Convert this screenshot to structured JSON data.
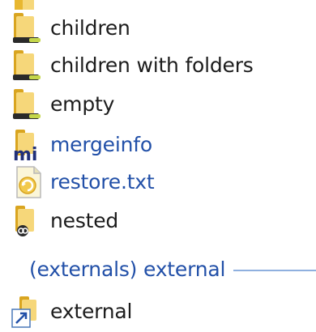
{
  "items": [
    {
      "label": "children",
      "icon": "folder-normal-icon",
      "style": "dark"
    },
    {
      "label": "children with folders",
      "icon": "folder-normal-icon",
      "style": "dark"
    },
    {
      "label": "empty",
      "icon": "folder-normal-icon",
      "style": "dark"
    },
    {
      "label": "mergeinfo",
      "icon": "folder-mergeinfo-icon",
      "style": "blue"
    },
    {
      "label": "restore.txt",
      "icon": "file-restore-icon",
      "style": "blue"
    },
    {
      "label": "nested",
      "icon": "folder-nested-icon",
      "style": "dark"
    }
  ],
  "externals_group": {
    "title": "(externals) external",
    "items": [
      {
        "label": "external",
        "icon": "external-link-icon",
        "style": "dark"
      }
    ]
  },
  "colors": {
    "folder_yellow": "#f2c94c",
    "text_dark": "#1c1c1c",
    "text_blue": "#2250a8",
    "group_line": "#8fb0df"
  }
}
